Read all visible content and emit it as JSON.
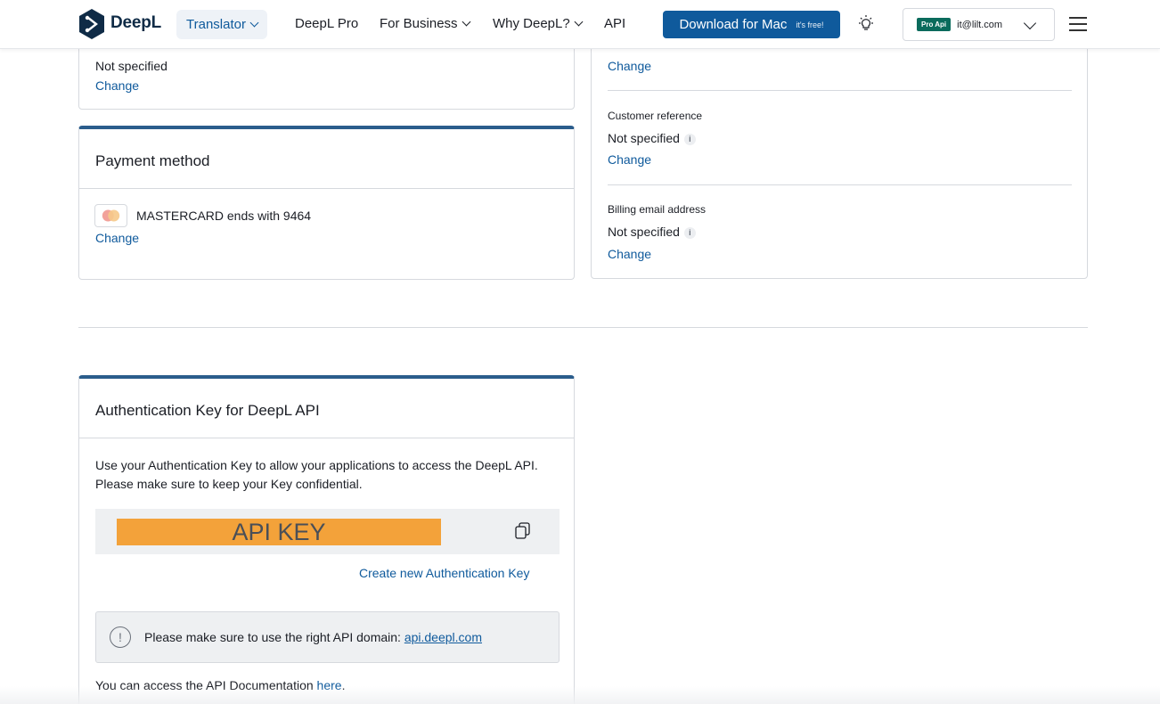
{
  "nav": {
    "brand": "DeepL",
    "translator": "Translator",
    "pro": "DeepL Pro",
    "business": "For Business",
    "why": "Why DeepL?",
    "api": "API",
    "download_label": "Download for Mac",
    "download_badge": "it's free!",
    "account_badge": "Pro Api",
    "account_email": "it@lilt.com",
    "icons": [
      "deepl-logo-icon",
      "lightbulb-icon",
      "chevron-down-icon",
      "hamburger-menu-icon"
    ],
    "colors": {
      "brand_blue": "#0f5a9c",
      "badge_green": "#0a6b5c",
      "accent_border": "#2b5d8c"
    }
  },
  "billing_left": {
    "value": "Not specified",
    "change": "Change"
  },
  "payment": {
    "title": "Payment method",
    "card_text": "MASTERCARD ends with 9464",
    "change": "Change"
  },
  "billing_right": {
    "top_change": "Change",
    "customer_reference": {
      "label": "Customer reference",
      "value": "Not specified",
      "change": "Change"
    },
    "billing_email": {
      "label": "Billing email address",
      "value": "Not specified",
      "change": "Change"
    }
  },
  "auth": {
    "title": "Authentication Key for DeepL API",
    "desc_line1": "Use your Authentication Key to allow your applications to access the DeepL API.",
    "desc_line2": "Please make sure to keep your Key confidential.",
    "key_placeholder": "API KEY",
    "create_key": "Create new Authentication Key",
    "notice_text": "Please make sure to use the right API domain:",
    "notice_domain": "api.deepl.com",
    "doc_text": "You can access the API Documentation",
    "doc_link": "here",
    "doc_period": "."
  }
}
